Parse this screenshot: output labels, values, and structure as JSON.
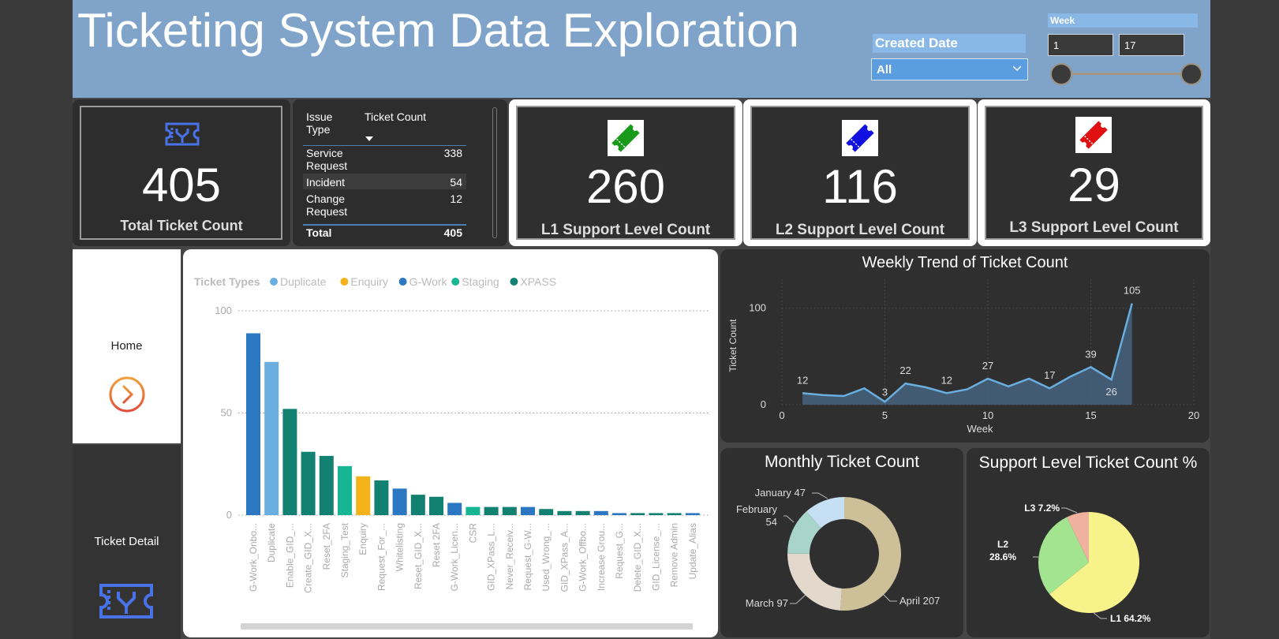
{
  "header": {
    "title": "Ticketing System Data Exploration",
    "created_date_label": "Created Date",
    "created_date_value": "All",
    "week_label": "Week",
    "week_min": "1",
    "week_max": "17"
  },
  "cards": {
    "total": {
      "value": "405",
      "label": "Total Ticket Count",
      "icon": "ticket-icon"
    },
    "l1": {
      "value": "260",
      "label": "L1 Support Level Count",
      "icon": "ticket-icon",
      "color": "#1a9a1a"
    },
    "l2": {
      "value": "116",
      "label": "L2 Support Level Count",
      "icon": "ticket-icon",
      "color": "#1010e0"
    },
    "l3": {
      "value": "29",
      "label": "L3 Support Level Count",
      "icon": "ticket-icon",
      "color": "#e01010"
    }
  },
  "matrix": {
    "col1": "Issue Type",
    "col2": "Ticket Count",
    "rows": [
      {
        "type": "Service Request",
        "count": "338"
      },
      {
        "type": "Incident",
        "count": "54"
      },
      {
        "type": "Change Request",
        "count": "12"
      }
    ],
    "total_label": "Total",
    "total_value": "405"
  },
  "nav": {
    "home": "Home",
    "detail": "Ticket Detail"
  },
  "colors": {
    "duplicate": "#6aaee0",
    "enquiry": "#f5b21b",
    "gwork": "#2b77c2",
    "staging": "#16b594",
    "xpass": "#138171",
    "header": "#7fa3c9",
    "line": "#6aaee0"
  },
  "chart_data": [
    {
      "type": "bar",
      "legend_title": "Ticket Types",
      "legend": [
        "Duplicate",
        "Enquiry",
        "G-Work",
        "Staging",
        "XPASS"
      ],
      "ylim": [
        0,
        100
      ],
      "yticks": [
        "0",
        "50",
        "100"
      ],
      "categories": [
        "G-Work_Onbo...",
        "Duplicate",
        "Enable_GID_...",
        "Create_GID_X...",
        "Reset_2FA",
        "Staging_Test",
        "Enquiry",
        "Request_For_...",
        "Whitelisting",
        "Reset_GID_X...",
        "Reset 2FA",
        "G-Work_Licen...",
        "CSR",
        "GID_XPass_L...",
        "Never_Receiv...",
        "Request_G-W...",
        "Used_Wrong_...",
        "GID_XPass_A...",
        "G-Work_Offbo...",
        "Increase Grou...",
        "Request_G...",
        "Delete_GID_X...",
        "GID_License_...",
        "Remove Admin",
        "Update_Alias"
      ],
      "values": [
        89,
        75,
        52,
        31,
        29,
        24,
        19,
        17,
        13,
        10,
        9,
        6,
        4,
        4,
        4,
        4,
        3,
        2,
        2,
        2,
        1,
        1,
        1,
        1,
        1
      ],
      "groups": [
        "G-Work",
        "Duplicate",
        "XPASS",
        "XPASS",
        "XPASS",
        "Staging",
        "Enquiry",
        "XPASS",
        "G-Work",
        "XPASS",
        "XPASS",
        "G-Work",
        "Staging",
        "XPASS",
        "XPASS",
        "G-Work",
        "XPASS",
        "XPASS",
        "XPASS",
        "G-Work",
        "G-Work",
        "XPASS",
        "XPASS",
        "XPASS",
        "G-Work"
      ]
    },
    {
      "type": "area",
      "title": "Weekly Trend of Ticket Count",
      "xlabel": "Week",
      "ylabel": "Ticket Count",
      "xlim": [
        0,
        20
      ],
      "ylim": [
        0,
        130
      ],
      "xticks": [
        "0",
        "5",
        "10",
        "15",
        "20"
      ],
      "yticks": [
        "0",
        "100"
      ],
      "x": [
        1,
        2,
        3,
        4,
        5,
        6,
        7,
        8,
        9,
        10,
        11,
        12,
        13,
        14,
        15,
        16,
        17
      ],
      "y": [
        12,
        10,
        9,
        17,
        3,
        22,
        18,
        12,
        16,
        27,
        19,
        27,
        17,
        29,
        39,
        26,
        105
      ],
      "labels": [
        {
          "x": 1,
          "y": 12,
          "text": "12"
        },
        {
          "x": 5,
          "y": 3,
          "text": "3"
        },
        {
          "x": 6,
          "y": 22,
          "text": "22"
        },
        {
          "x": 8,
          "y": 12,
          "text": "12"
        },
        {
          "x": 10,
          "y": 27,
          "text": "27"
        },
        {
          "x": 13,
          "y": 17,
          "text": "17"
        },
        {
          "x": 15,
          "y": 39,
          "text": "39"
        },
        {
          "x": 16,
          "y": 26,
          "text": "26"
        },
        {
          "x": 17,
          "y": 105,
          "text": "105"
        }
      ]
    },
    {
      "type": "pie",
      "title": "Monthly Ticket Count",
      "donut": true,
      "slices": [
        {
          "label": "April",
          "value": 207,
          "color": "#cdbf98",
          "text": "April 207"
        },
        {
          "label": "March",
          "value": 97,
          "color": "#e2d9cc",
          "text": "March 97"
        },
        {
          "label": "February",
          "value": 54,
          "color": "#a8d4cb",
          "text": "February 54"
        },
        {
          "label": "January",
          "value": 47,
          "color": "#c6dff2",
          "text": "January 47"
        }
      ]
    },
    {
      "type": "pie",
      "title": "Support Level Ticket Count %",
      "slices": [
        {
          "label": "L1",
          "value": 64.2,
          "color": "#f8f28a",
          "text": "L1 64.2%"
        },
        {
          "label": "L2",
          "value": 28.6,
          "color": "#a2e490",
          "text": "L2 28.6%"
        },
        {
          "label": "L3",
          "value": 7.2,
          "color": "#efb29e",
          "text": "L3 7.2%"
        }
      ]
    }
  ]
}
